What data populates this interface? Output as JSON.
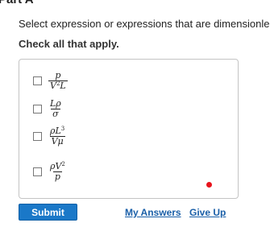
{
  "header": {
    "part_title": "Part A"
  },
  "question": {
    "prompt": "Select expression or expressions that are dimensionle",
    "instruction": "Check all that apply."
  },
  "choices": [
    {
      "numerator": "p",
      "denominator": "V",
      "denominator_sup": "2",
      "denominator_tail": "L",
      "checked": false
    },
    {
      "numerator": "Lρ",
      "denominator": "σ",
      "checked": false
    },
    {
      "numerator": "ρL",
      "numerator_sup": "3",
      "denominator": "Vμ",
      "checked": false
    },
    {
      "numerator": "ρV",
      "numerator_sup": "2",
      "denominator": "p",
      "checked": false
    }
  ],
  "actions": {
    "submit_label": "Submit",
    "my_answers_label": "My Answers",
    "give_up_label": "Give Up"
  },
  "colors": {
    "submit_bg": "#1a78c8",
    "link": "#1a5fa8",
    "status_dot": "#e8141c"
  }
}
